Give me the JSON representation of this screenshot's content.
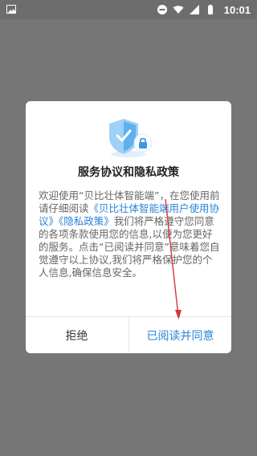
{
  "status_bar": {
    "time": "10:01",
    "icons": [
      "gallery-icon",
      "dnd-icon",
      "wifi-icon",
      "signal-icon",
      "battery-icon"
    ]
  },
  "dialog": {
    "title": "服务协议和隐私政策",
    "body": {
      "part1": "欢迎使用“贝比壮体智能端”，在您使用前请仔细阅读",
      "link1": "《贝比壮体智能端用户使用协议》",
      "link2": "《隐私政策》",
      "part2": "我们将严格遵守您同意的各项条款使用您的信息,以便为您更好的服务。点击“已阅读并同意”意味着您自觉遵守以上协议,我们将严格保护您的个人信息,确保信息安全。"
    },
    "buttons": {
      "reject": "拒绝",
      "accept": "已阅读并同意"
    }
  },
  "colors": {
    "link": "#2a84d8",
    "accept_button": "#2a84d8",
    "annotation_arrow": "#d9343a",
    "overlay": "#767676"
  }
}
